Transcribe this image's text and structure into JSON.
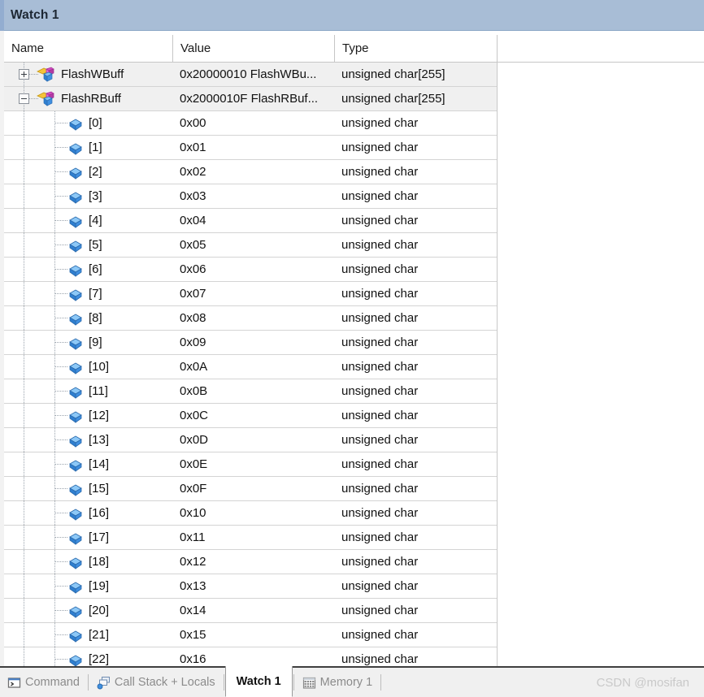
{
  "window": {
    "title": "Watch 1"
  },
  "grid": {
    "columns": [
      {
        "key": "name",
        "label": "Name"
      },
      {
        "key": "value",
        "label": "Value"
      },
      {
        "key": "type",
        "label": "Type"
      }
    ],
    "rows": [
      {
        "level": 0,
        "expander": "plus",
        "icon": "array-variable-icon",
        "name": "FlashWBuff",
        "value": "0x20000010 FlashWBu...",
        "type": "unsigned char[255]",
        "highlighted": true
      },
      {
        "level": 0,
        "expander": "minus",
        "icon": "array-variable-icon",
        "name": "FlashRBuff",
        "value": "0x2000010F FlashRBuf...",
        "type": "unsigned char[255]",
        "highlighted": true
      },
      {
        "level": 1,
        "expander": "none",
        "icon": "variable-icon",
        "name": "[0]",
        "value": "0x00",
        "type": "unsigned char",
        "highlighted": false
      },
      {
        "level": 1,
        "expander": "none",
        "icon": "variable-icon",
        "name": "[1]",
        "value": "0x01",
        "type": "unsigned char",
        "highlighted": false
      },
      {
        "level": 1,
        "expander": "none",
        "icon": "variable-icon",
        "name": "[2]",
        "value": "0x02",
        "type": "unsigned char",
        "highlighted": false
      },
      {
        "level": 1,
        "expander": "none",
        "icon": "variable-icon",
        "name": "[3]",
        "value": "0x03",
        "type": "unsigned char",
        "highlighted": false
      },
      {
        "level": 1,
        "expander": "none",
        "icon": "variable-icon",
        "name": "[4]",
        "value": "0x04",
        "type": "unsigned char",
        "highlighted": false
      },
      {
        "level": 1,
        "expander": "none",
        "icon": "variable-icon",
        "name": "[5]",
        "value": "0x05",
        "type": "unsigned char",
        "highlighted": false
      },
      {
        "level": 1,
        "expander": "none",
        "icon": "variable-icon",
        "name": "[6]",
        "value": "0x06",
        "type": "unsigned char",
        "highlighted": false
      },
      {
        "level": 1,
        "expander": "none",
        "icon": "variable-icon",
        "name": "[7]",
        "value": "0x07",
        "type": "unsigned char",
        "highlighted": false
      },
      {
        "level": 1,
        "expander": "none",
        "icon": "variable-icon",
        "name": "[8]",
        "value": "0x08",
        "type": "unsigned char",
        "highlighted": false
      },
      {
        "level": 1,
        "expander": "none",
        "icon": "variable-icon",
        "name": "[9]",
        "value": "0x09",
        "type": "unsigned char",
        "highlighted": false
      },
      {
        "level": 1,
        "expander": "none",
        "icon": "variable-icon",
        "name": "[10]",
        "value": "0x0A",
        "type": "unsigned char",
        "highlighted": false
      },
      {
        "level": 1,
        "expander": "none",
        "icon": "variable-icon",
        "name": "[11]",
        "value": "0x0B",
        "type": "unsigned char",
        "highlighted": false
      },
      {
        "level": 1,
        "expander": "none",
        "icon": "variable-icon",
        "name": "[12]",
        "value": "0x0C",
        "type": "unsigned char",
        "highlighted": false
      },
      {
        "level": 1,
        "expander": "none",
        "icon": "variable-icon",
        "name": "[13]",
        "value": "0x0D",
        "type": "unsigned char",
        "highlighted": false
      },
      {
        "level": 1,
        "expander": "none",
        "icon": "variable-icon",
        "name": "[14]",
        "value": "0x0E",
        "type": "unsigned char",
        "highlighted": false
      },
      {
        "level": 1,
        "expander": "none",
        "icon": "variable-icon",
        "name": "[15]",
        "value": "0x0F",
        "type": "unsigned char",
        "highlighted": false
      },
      {
        "level": 1,
        "expander": "none",
        "icon": "variable-icon",
        "name": "[16]",
        "value": "0x10",
        "type": "unsigned char",
        "highlighted": false
      },
      {
        "level": 1,
        "expander": "none",
        "icon": "variable-icon",
        "name": "[17]",
        "value": "0x11",
        "type": "unsigned char",
        "highlighted": false
      },
      {
        "level": 1,
        "expander": "none",
        "icon": "variable-icon",
        "name": "[18]",
        "value": "0x12",
        "type": "unsigned char",
        "highlighted": false
      },
      {
        "level": 1,
        "expander": "none",
        "icon": "variable-icon",
        "name": "[19]",
        "value": "0x13",
        "type": "unsigned char",
        "highlighted": false
      },
      {
        "level": 1,
        "expander": "none",
        "icon": "variable-icon",
        "name": "[20]",
        "value": "0x14",
        "type": "unsigned char",
        "highlighted": false
      },
      {
        "level": 1,
        "expander": "none",
        "icon": "variable-icon",
        "name": "[21]",
        "value": "0x15",
        "type": "unsigned char",
        "highlighted": false
      },
      {
        "level": 1,
        "expander": "none",
        "icon": "variable-icon",
        "name": "[22]",
        "value": "0x16",
        "type": "unsigned char",
        "highlighted": false
      }
    ]
  },
  "tabbar": {
    "tabs": [
      {
        "label": "Command",
        "icon": "command-prompt-icon",
        "active": false
      },
      {
        "label": "Call Stack + Locals",
        "icon": "call-stack-icon",
        "active": false
      },
      {
        "label": "Watch 1",
        "icon": "none",
        "active": true
      },
      {
        "label": "Memory 1",
        "icon": "memory-grid-icon",
        "active": false
      }
    ],
    "watermark": "CSDN @mosifan"
  },
  "colors": {
    "titlebar": "#a8bdd6",
    "row_highlight": "#f0f0f0",
    "grid_line": "#d4d4d4",
    "icon_array_yellow": "#f5c43a",
    "icon_cube_blue": "#3f8fe0",
    "icon_cube_magenta": "#d44ec4",
    "watermark": "#c9c9c9"
  }
}
